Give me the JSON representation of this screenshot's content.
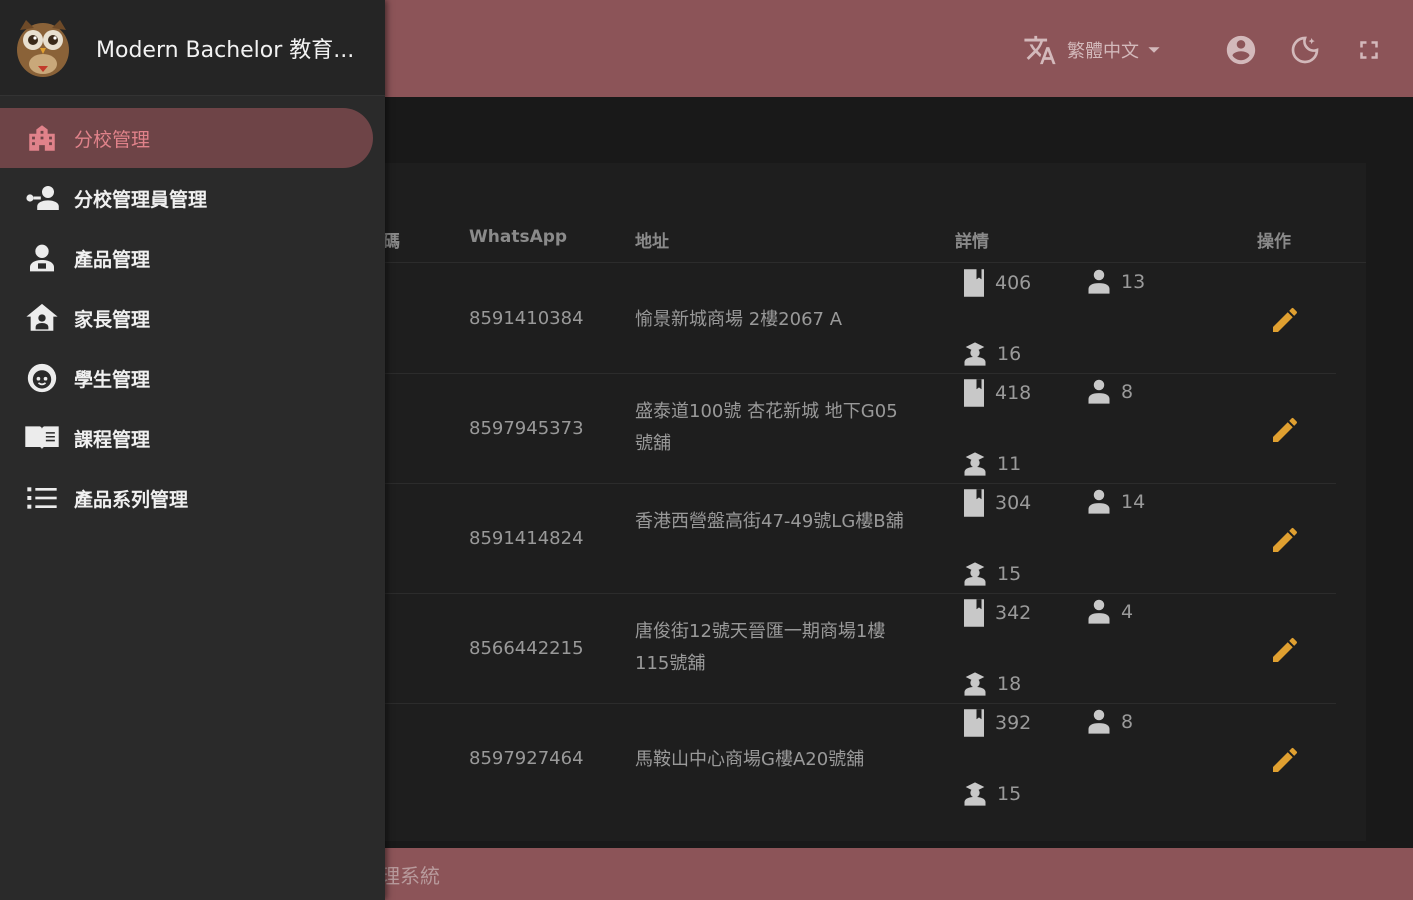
{
  "appbar": {
    "language": "繁體中文",
    "bg_color": "#8c5458"
  },
  "table": {
    "headers": {
      "code_partial": "碼",
      "whatsapp": "WhatsApp",
      "address": "地址",
      "details": "詳情",
      "actions": "操作"
    },
    "rows": [
      {
        "whatsapp": "8591410384",
        "address": "愉景新城商場 2樓2067 A",
        "books": "406",
        "parents": "13",
        "students": "16"
      },
      {
        "whatsapp": "8597945373",
        "address": "盛泰道100號 杏花新城 地下G05號舖",
        "books": "418",
        "parents": "8",
        "students": "11"
      },
      {
        "whatsapp": "8591414824",
        "address": "香港西營盤高街47-49號LG樓B舖",
        "books": "304",
        "parents": "14",
        "students": "15"
      },
      {
        "whatsapp": "8566442215",
        "address": "唐俊街12號天晉匯一期商場1樓115號舖",
        "books": "342",
        "parents": "4",
        "students": "18"
      },
      {
        "whatsapp": "8597927464",
        "address": "馬鞍山中心商場G樓A20號舖",
        "books": "392",
        "parents": "8",
        "students": "15"
      }
    ]
  },
  "footer": {
    "text_partial": "理系統"
  },
  "drawer": {
    "title": "Modern Bachelor 教育...",
    "items": [
      {
        "label": "分校管理",
        "icon": "school-icon",
        "active": true
      },
      {
        "label": "分校管理員管理",
        "icon": "manage-accounts-icon",
        "active": false
      },
      {
        "label": "產品管理",
        "icon": "person-badge-icon",
        "active": false
      },
      {
        "label": "家長管理",
        "icon": "house-person-icon",
        "active": false
      },
      {
        "label": "學生管理",
        "icon": "face-icon",
        "active": false
      },
      {
        "label": "課程管理",
        "icon": "book-icon",
        "active": false
      },
      {
        "label": "產品系列管理",
        "icon": "list-icon",
        "active": false
      }
    ]
  },
  "colors": {
    "accent": "#8c5458",
    "active_nav": "#6e4447",
    "active_text": "#e0828a",
    "edit_icon": "#e0a030"
  }
}
